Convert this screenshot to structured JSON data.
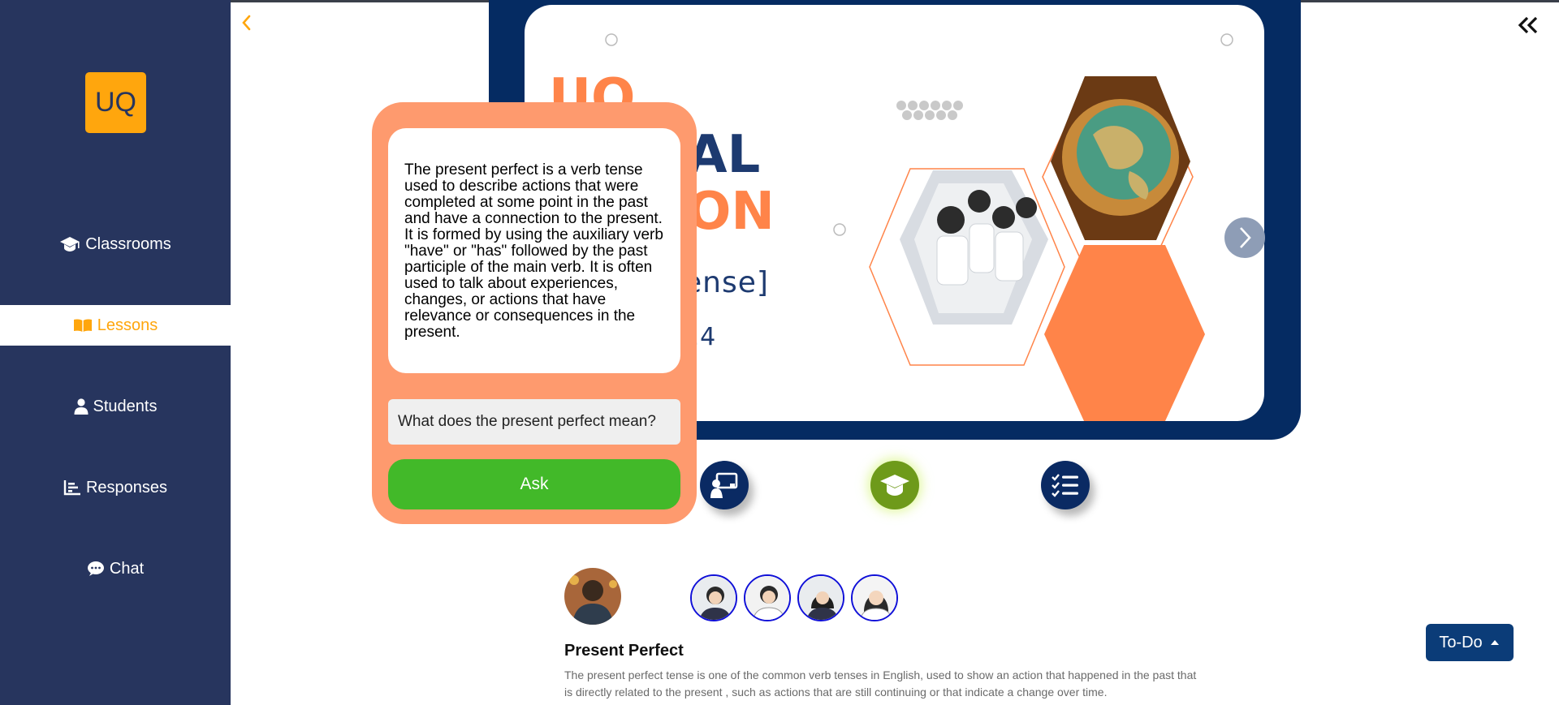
{
  "sidebar": {
    "logo_text": "UQ",
    "items": [
      {
        "label": "Classrooms",
        "icon": "graduation-cap-icon"
      },
      {
        "label": "Lessons",
        "icon": "book-open-icon",
        "active": true
      },
      {
        "label": "Students",
        "icon": "user-icon"
      },
      {
        "label": "Responses",
        "icon": "bar-chart-icon"
      },
      {
        "label": "Chat",
        "icon": "comment-icon"
      }
    ]
  },
  "slide": {
    "title_line1": "UQ",
    "title_line2": "AL",
    "title_line3": "ON",
    "subtitle": "ense]",
    "date_fragment": "24"
  },
  "chat": {
    "answer": "The present perfect is a verb tense used to describe actions that were completed at some point in the past and have a connection to the present. It is formed by using the auxiliary verb \"have\" or \"has\" followed by the past participle of the main verb. It is often used to talk about experiences, changes, or actions that have relevance or consequences in the present.",
    "question_value": "What does the present perfect mean?",
    "ask_label": "Ask"
  },
  "lesson": {
    "title": "Present Perfect",
    "description": "The present perfect tense is one of the common verb tenses in English, used to show an action that happened in the past that is directly related to the present , such as actions that are still continuing or that indicate a change over time."
  },
  "todo": {
    "label": "To-Do"
  },
  "colors": {
    "sidebar": "#27355e",
    "accent": "#ffa60d",
    "slide_frame": "#052b62",
    "slide_orange": "#ff8449",
    "popup": "#fe9a6e",
    "ask_green": "#42b929",
    "todo": "#0b3c78"
  }
}
